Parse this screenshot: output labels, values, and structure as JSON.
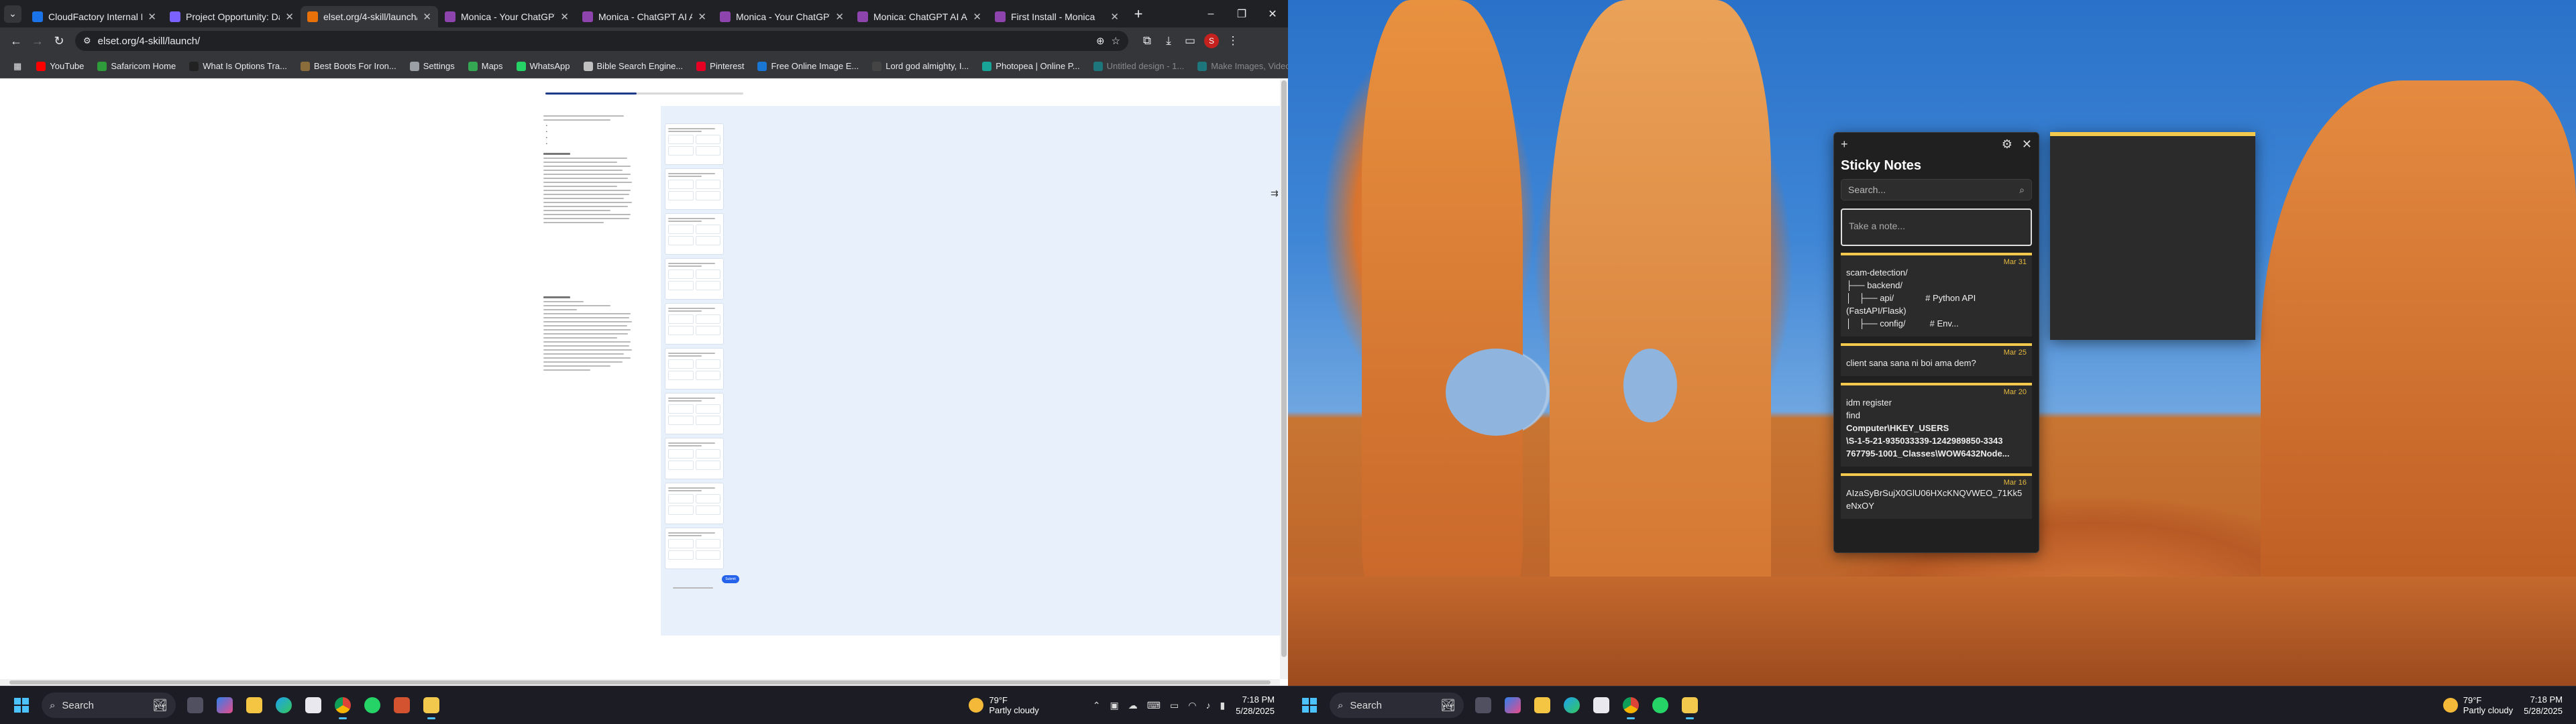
{
  "browser": {
    "tabs": [
      {
        "title": "CloudFactory Internal Em",
        "active": false,
        "color": "#1a73e8"
      },
      {
        "title": "Project Opportunity: Data",
        "active": false,
        "color": "#7b61ff"
      },
      {
        "title": "elset.org/4-skill/launch/",
        "active": true,
        "color": "#e8710a"
      },
      {
        "title": "Monica - Your ChatGPT A",
        "active": false,
        "color": "#8e44ad"
      },
      {
        "title": "Monica - ChatGPT AI Ass",
        "active": false,
        "color": "#8e44ad"
      },
      {
        "title": "Monica - Your ChatGPT A",
        "active": false,
        "color": "#8e44ad"
      },
      {
        "title": "Monica: ChatGPT AI Assis",
        "active": false,
        "color": "#8e44ad"
      },
      {
        "title": "First Install - Monica",
        "active": false,
        "color": "#8e44ad"
      }
    ],
    "url": "elset.org/4-skill/launch/",
    "bookmarks": [
      {
        "label": "YouTube",
        "color": "#ff0000"
      },
      {
        "label": "Safaricom Home",
        "color": "#2e9c3a"
      },
      {
        "label": "What Is Options Tra...",
        "color": "#222222"
      },
      {
        "label": "Best Boots For Iron...",
        "color": "#8a6d3b"
      },
      {
        "label": "Settings",
        "color": "#9aa0a6"
      },
      {
        "label": "Maps",
        "color": "#34a853"
      },
      {
        "label": "WhatsApp",
        "color": "#25d366"
      },
      {
        "label": "Bible Search Engine...",
        "color": "#c0c0c0"
      },
      {
        "label": "Pinterest",
        "color": "#e60023"
      },
      {
        "label": "Free Online Image E...",
        "color": "#1976d2"
      },
      {
        "label": "Lord god almighty, I...",
        "color": "#444444"
      },
      {
        "label": "Photopea | Online P...",
        "color": "#18a497"
      },
      {
        "label": "Untitled design - 1...",
        "color": "#00c4cc",
        "dim": true
      },
      {
        "label": "Make Images, Video...",
        "color": "#00c4cc",
        "dim": true
      }
    ]
  },
  "page": {
    "progress": 0.46,
    "submit_label": "Submit"
  },
  "sticky_notes": {
    "title": "Sticky Notes",
    "search_placeholder": "Search...",
    "take_note_placeholder": "Take a note...",
    "notes": [
      {
        "date": "Mar 31",
        "lines": [
          {
            "text": "scam-detection/",
            "bold": false
          },
          {
            "text": "├── backend/",
            "bold": false
          },
          {
            "text": "│   ├── api/             # Python API",
            "bold": false
          },
          {
            "text": "(FastAPI/Flask)",
            "bold": false
          },
          {
            "text": "│   ├── config/          # Env...",
            "bold": false
          }
        ]
      },
      {
        "date": "Mar 25",
        "lines": [
          {
            "text": "client sana sana ni boi ama dem?",
            "bold": false
          }
        ]
      },
      {
        "date": "Mar 20",
        "lines": [
          {
            "text": "idm register",
            "bold": false
          },
          {
            "text": "find",
            "bold": false
          },
          {
            "text": "Computer\\HKEY_USERS",
            "bold": true
          },
          {
            "text": "\\S-1-5-21-935033339-1242989850-3343",
            "bold": true
          },
          {
            "text": "767795-1001_Classes\\WOW6432Node...",
            "bold": true
          }
        ]
      },
      {
        "date": "Mar 16",
        "lines": [
          {
            "text": "AIzaSyBrSujX0GlU06HXcKNQVWEO_71Kk5",
            "bold": false
          },
          {
            "text": "eNxOY",
            "bold": false
          }
        ]
      }
    ]
  },
  "taskbar": {
    "search_label": "Search",
    "weather_temp": "79°F",
    "weather_desc": "Partly cloudy",
    "time": "7:18 PM",
    "date": "5/28/2025"
  }
}
